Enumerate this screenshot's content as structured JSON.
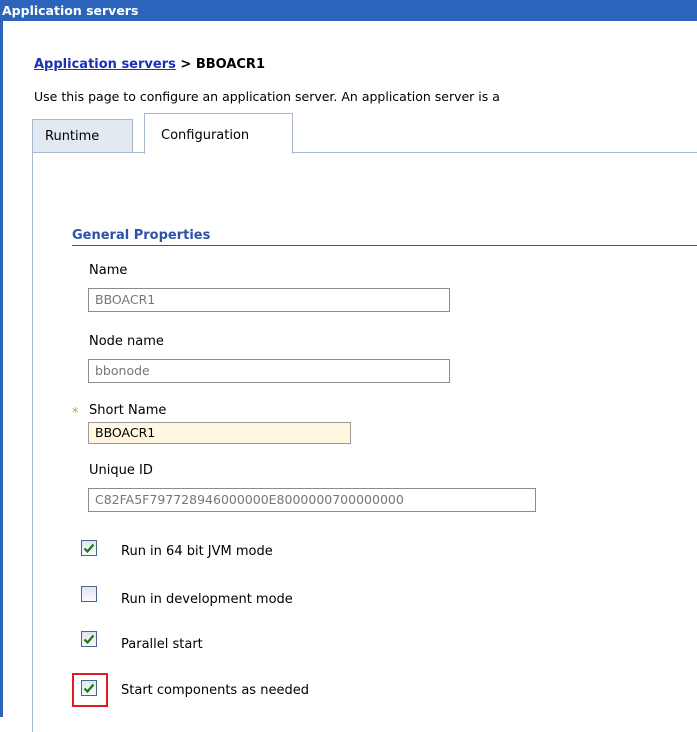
{
  "window": {
    "title": "Application servers"
  },
  "breadcrumb": {
    "parent_link": "Application servers",
    "separator": " > ",
    "current": "BBOACR1"
  },
  "description": "Use this page to configure an application server. An application server is a",
  "tabs": [
    {
      "label": "Runtime",
      "active": false
    },
    {
      "label": "Configuration",
      "active": true
    }
  ],
  "general_properties": {
    "title": "General Properties",
    "name": {
      "label": "Name",
      "value": "BBOACR1"
    },
    "node_name": {
      "label": "Node name",
      "value": "bbonode"
    },
    "short_name": {
      "label": "Short Name",
      "value": "BBOACR1",
      "required_marker": "*"
    },
    "unique_id": {
      "label": "Unique ID",
      "value": "C82FA5F797728946000000E8000000700000000"
    },
    "checkboxes": [
      {
        "label": "Run in 64 bit JVM mode",
        "checked": true
      },
      {
        "label": "Run in development mode",
        "checked": false
      },
      {
        "label": "Parallel start",
        "checked": true
      },
      {
        "label": "Start components as needed",
        "checked": true
      }
    ]
  },
  "colors": {
    "title_bar": "#2d64bb",
    "link": "#1c30b5",
    "section_title": "#2c53a8",
    "highlight": "#e01b24",
    "check": "#1a7a1a"
  }
}
